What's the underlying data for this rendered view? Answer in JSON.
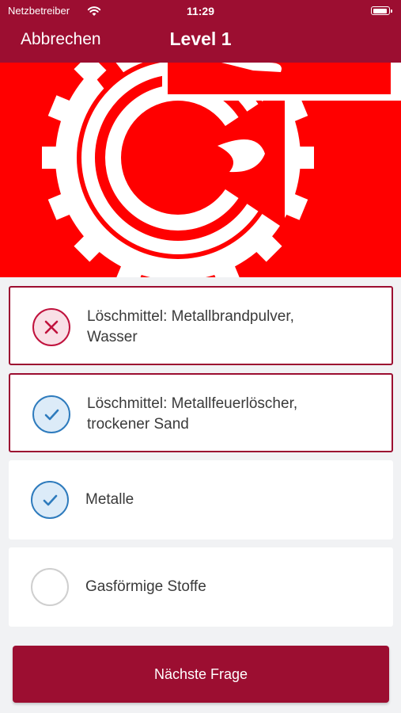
{
  "status_bar": {
    "carrier": "Netzbetreiber",
    "time": "11:29"
  },
  "nav": {
    "cancel_label": "Abbrechen",
    "title": "Level 1"
  },
  "colors": {
    "header": "#9c0e31",
    "hero_bg": "#ff0000",
    "wrong": "#c0123d",
    "correct": "#2e7bbd"
  },
  "answers": [
    {
      "line1": "Löschmittel: Metallbrandpulver,",
      "line2": "Wasser",
      "selected": true,
      "result": "wrong",
      "icon": "close-icon"
    },
    {
      "line1": "Löschmittel: Metallfeuerlöscher,",
      "line2": "trockener Sand",
      "selected": true,
      "result": "correct",
      "icon": "checkmark-icon"
    },
    {
      "line1": "Metalle",
      "line2": "",
      "selected": false,
      "result": "correct",
      "icon": "checkmark-icon"
    },
    {
      "line1": "Gasförmige Stoffe",
      "line2": "",
      "selected": false,
      "result": "none",
      "icon": "empty-circle-icon"
    }
  ],
  "next_button_label": "Nächste Frage"
}
